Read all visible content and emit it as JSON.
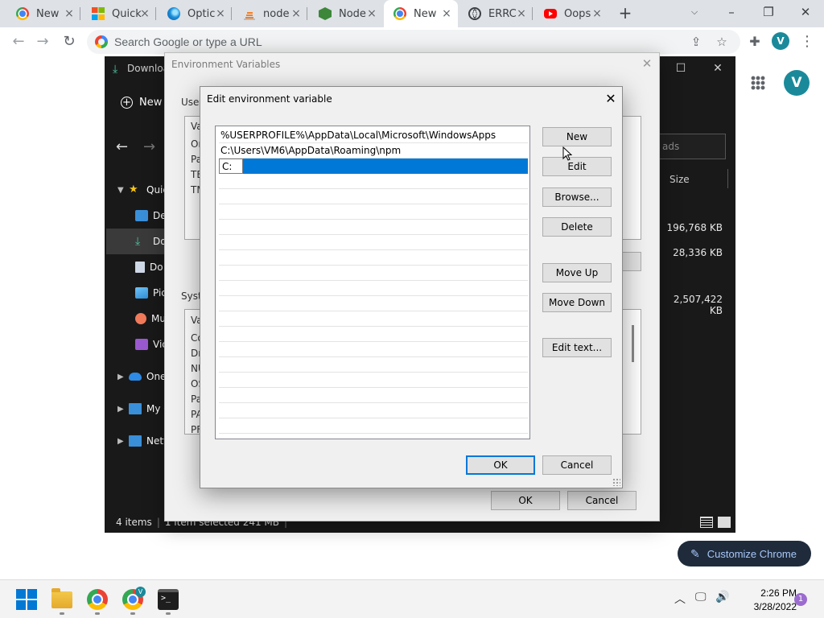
{
  "browser": {
    "tabs": [
      {
        "title": "New",
        "icon": "chrome-icon"
      },
      {
        "title": "Quick",
        "icon": "microsoft-icon"
      },
      {
        "title": "Optic",
        "icon": "edge-icon"
      },
      {
        "title": "node",
        "icon": "stackoverflow-icon"
      },
      {
        "title": "Node",
        "icon": "nodejs-icon"
      },
      {
        "title": "New",
        "icon": "chrome-icon",
        "active": true
      },
      {
        "title": "ERRC",
        "icon": "globe-icon"
      },
      {
        "title": "Oops",
        "icon": "youtube-icon"
      }
    ],
    "new_tab_symbol": "+",
    "omnibox_placeholder": "Search Google or type a URL",
    "profile_initial": "V"
  },
  "ntp": {
    "avatar_initial": "V",
    "customize_label": "Customize Chrome"
  },
  "explorer": {
    "title": "Downloa",
    "new_label": "New",
    "search_placeholder": "ads",
    "size_header": "Size",
    "sizes": [
      "196,768 KB",
      "28,336 KB",
      "2,507,422 KB"
    ],
    "nav": [
      {
        "label": "Quic",
        "icon": "star-icon"
      },
      {
        "label": "De",
        "icon": "desktop-icon"
      },
      {
        "label": "Do",
        "icon": "download-icon"
      },
      {
        "label": "Do",
        "icon": "document-icon"
      },
      {
        "label": "Pic",
        "icon": "pictures-icon"
      },
      {
        "label": "Mu",
        "icon": "music-icon"
      },
      {
        "label": "Vic",
        "icon": "video-icon"
      },
      {
        "label": "One",
        "icon": "cloud-icon"
      },
      {
        "label": "My C",
        "icon": "computer-icon"
      },
      {
        "label": "Netv",
        "icon": "network-icon"
      }
    ],
    "status_items": "4 items",
    "status_selected": "1 item selected  241 MB"
  },
  "env_dialog": {
    "title": "Environment Variables",
    "user_label": "User",
    "system_label": "Syste",
    "user_header": "Va",
    "user_rows": [
      "Or",
      "Pa",
      "TE",
      "TM"
    ],
    "system_header": "Va",
    "system_rows": [
      "Co",
      "Dr",
      "NU",
      "OS",
      "Pa",
      "PA",
      "PF"
    ],
    "ok_label": "OK",
    "cancel_label": "Cancel"
  },
  "edit_dialog": {
    "title": "Edit environment variable",
    "paths": [
      "%USERPROFILE%\\AppData\\Local\\Microsoft\\WindowsApps",
      "C:\\Users\\VM6\\AppData\\Roaming\\npm"
    ],
    "editing_value": "C:",
    "buttons": {
      "new": "New",
      "edit": "Edit",
      "browse": "Browse...",
      "delete": "Delete",
      "move_up": "Move Up",
      "move_down": "Move Down",
      "edit_text": "Edit text..."
    },
    "ok_label": "OK",
    "cancel_label": "Cancel"
  },
  "taskbar": {
    "time": "2:26 PM",
    "date": "3/28/2022",
    "notification_count": "1",
    "chrome_profile_badge": "V"
  }
}
